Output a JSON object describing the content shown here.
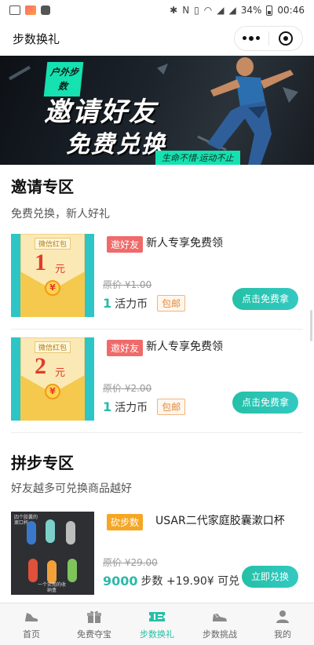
{
  "status_bar": {
    "battery": "34%",
    "time": "00:46"
  },
  "nav": {
    "title": "步数换礼"
  },
  "banner": {
    "tag": "户外步数",
    "headline1": "邀请好友",
    "headline2": "免费兑换",
    "slogan": "生命不惜·运动不止"
  },
  "invite_section": {
    "title": "邀请专区",
    "subtitle": "免费兑换，新人好礼",
    "items": [
      {
        "envelope_label": "微信红包",
        "amount": "1",
        "unit": "元",
        "coin": "¥",
        "badge": "邀好友",
        "name": "新人专享免费领",
        "original_price": "原价 ¥1.00",
        "price_num": "1",
        "price_unit": "活力币",
        "mail": "包邮",
        "button": "点击免费拿"
      },
      {
        "envelope_label": "微信红包",
        "amount": "2",
        "unit": "元",
        "coin": "¥",
        "badge": "邀好友",
        "name": "新人专享免费领",
        "original_price": "原价 ¥2.00",
        "price_num": "1",
        "price_unit": "活力币",
        "mail": "包邮",
        "button": "点击免费拿"
      }
    ]
  },
  "group_section": {
    "title": "拼步专区",
    "subtitle": "好友越多可兑换商品越好",
    "items": [
      {
        "img_text_top": "四个胶囊的漱口杯",
        "img_text_bottom": "一个实用的收纳盒",
        "badge": "砍步数",
        "name": "USAR二代家庭胶囊漱口杯",
        "original_price": "原价 ¥29.00",
        "price_num": "9000",
        "price_rest": "步数 +19.90¥ 可兑",
        "button": "立即兑换"
      }
    ]
  },
  "tabbar": {
    "tabs": [
      {
        "label": "首页",
        "icon": "shoe-icon"
      },
      {
        "label": "免费夺宝",
        "icon": "gift-icon"
      },
      {
        "label": "步数换礼",
        "icon": "ticket-icon"
      },
      {
        "label": "步数挑战",
        "icon": "sneaker-icon"
      },
      {
        "label": "我的",
        "icon": "user-icon"
      }
    ],
    "active": "步数换礼"
  },
  "colors": {
    "accent": "#26bfa6",
    "badge_red": "#f06a6a",
    "badge_orange": "#f5a623",
    "banner_green": "#16e1b0"
  }
}
